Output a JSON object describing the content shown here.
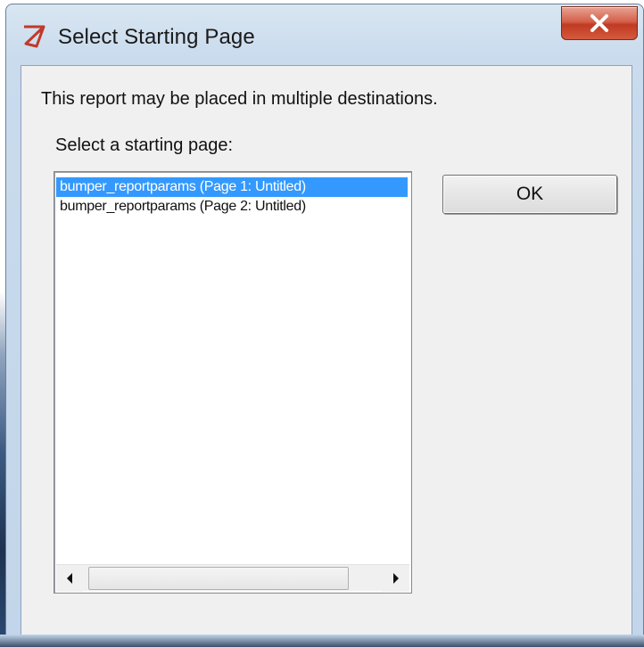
{
  "window": {
    "title": "Select Starting Page",
    "close_icon": "close-icon",
    "app_icon": "report-app-icon"
  },
  "dialog": {
    "message": "This report may be placed in multiple destinations.",
    "select_label": "Select a starting page:",
    "list_items": [
      "bumper_reportparams (Page 1: Untitled)",
      "bumper_reportparams (Page 2: Untitled)"
    ],
    "selected_index": 0,
    "ok_label": "OK"
  },
  "colors": {
    "selection": "#3399ff",
    "close_button": "#c03a22",
    "app_icon": "#c0392b"
  }
}
